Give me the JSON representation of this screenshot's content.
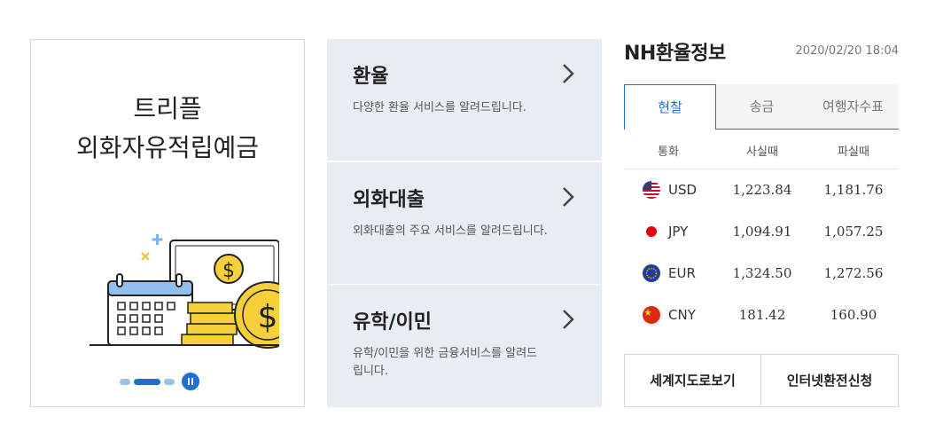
{
  "promo": {
    "title_line1": "트리플",
    "title_line2": "외화자유적립예금",
    "accent_color": "#1e6fd1"
  },
  "services": [
    {
      "title": "환율",
      "desc": "다양한 환율 서비스를 알려드립니다.",
      "arrow_icon": "chevron-right-icon"
    },
    {
      "title": "외화대출",
      "desc": "외화대출의 주요 서비스를 알려드립니다.",
      "arrow_icon": "chevron-right-icon"
    },
    {
      "title": "유학/이민",
      "desc": "유학/이민을 위한 금융서비스를 알려드립니다.",
      "arrow_icon": "chevron-right-icon"
    }
  ],
  "fx": {
    "title": "NH환율정보",
    "datetime": "2020/02/20 18:04",
    "tabs": [
      "현찰",
      "송금",
      "여행자수표"
    ],
    "active_tab": "현찰",
    "columns": [
      "통화",
      "사실때",
      "파실때"
    ],
    "rows": [
      {
        "currency": "USD",
        "flag": "us-flag-icon",
        "buy": "1,223.84",
        "sell": "1,181.76"
      },
      {
        "currency": "JPY",
        "flag": "jp-flag-icon",
        "buy": "1,094.91",
        "sell": "1,057.25"
      },
      {
        "currency": "EUR",
        "flag": "eu-flag-icon",
        "buy": "1,324.50",
        "sell": "1,272.56"
      },
      {
        "currency": "CNY",
        "flag": "cn-flag-icon",
        "buy": "181.42",
        "sell": "160.90"
      }
    ],
    "links": [
      "세계지도로보기",
      "인터넷환전신청"
    ]
  }
}
